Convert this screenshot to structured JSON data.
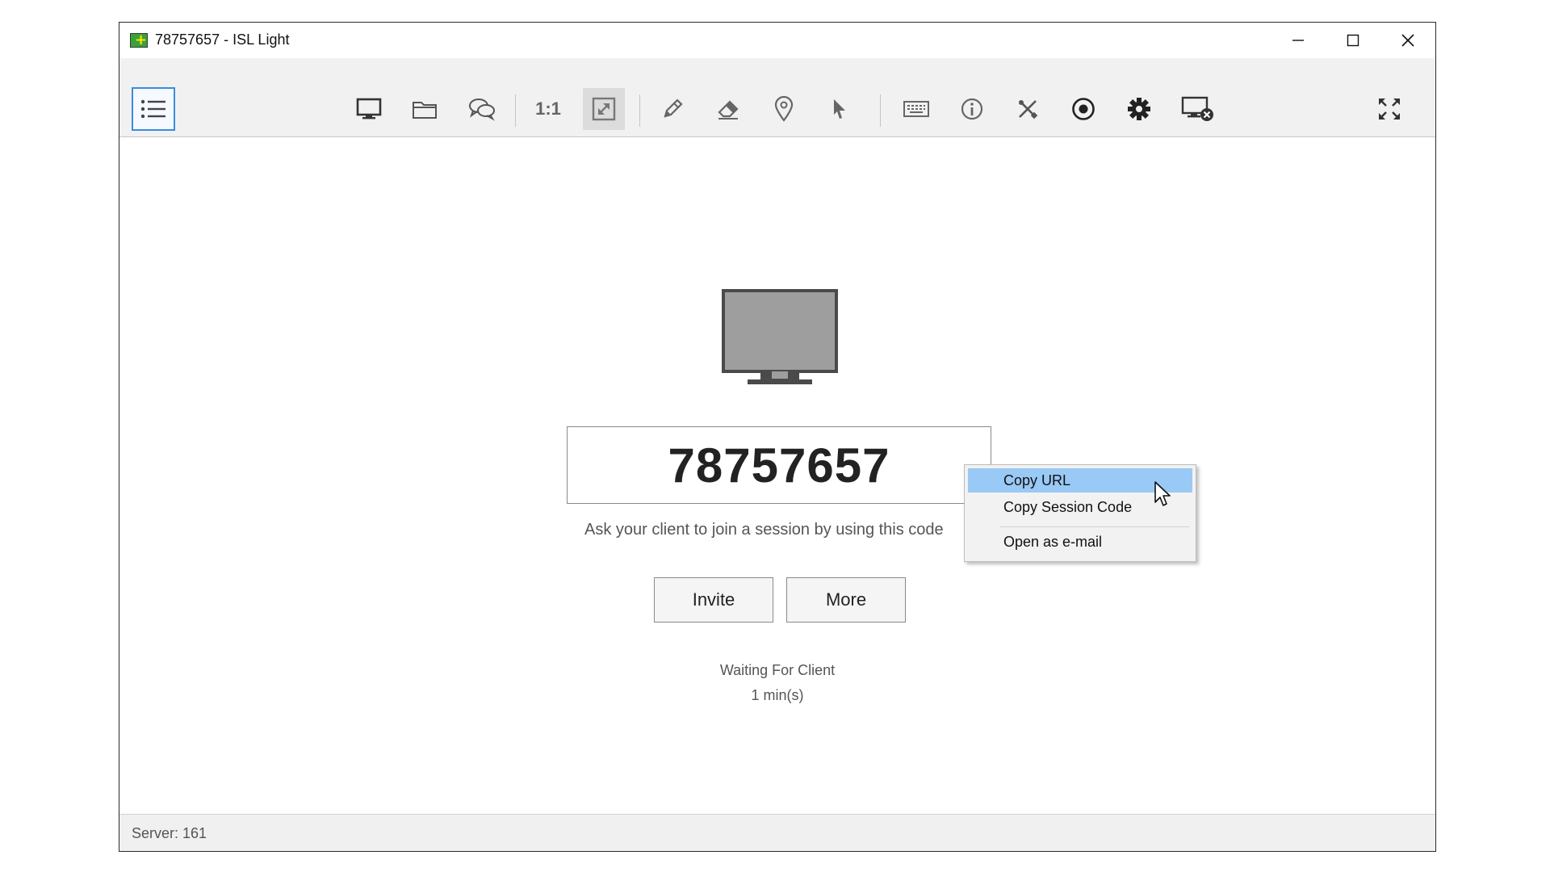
{
  "window": {
    "title": "78757657 - ISL Light",
    "controls": {
      "minimize_glyph": "—",
      "maximize_glyph": "☐",
      "close_glyph": "✕"
    }
  },
  "toolbar": {
    "menu_icon": "list-icon",
    "items": [
      {
        "name": "screen-share",
        "icon": "monitor-icon"
      },
      {
        "name": "file-transfer",
        "icon": "folder-icon"
      },
      {
        "name": "chat",
        "icon": "chat-icon"
      },
      {
        "name": "actual-size",
        "icon": "one-to-one-icon",
        "label": "1:1"
      },
      {
        "name": "scale-to-fit",
        "icon": "scale-icon",
        "active": true
      },
      {
        "name": "pen",
        "icon": "pencil-icon"
      },
      {
        "name": "eraser",
        "icon": "eraser-icon"
      },
      {
        "name": "pointer-marker",
        "icon": "map-pin-icon"
      },
      {
        "name": "pointer",
        "icon": "cursor-arrow-icon"
      },
      {
        "name": "keyboard",
        "icon": "keyboard-icon"
      },
      {
        "name": "info",
        "icon": "info-icon"
      },
      {
        "name": "tools",
        "icon": "tools-icon"
      },
      {
        "name": "record",
        "icon": "record-icon"
      },
      {
        "name": "settings",
        "icon": "gear-icon"
      },
      {
        "name": "disconnect",
        "icon": "monitor-close-icon"
      }
    ],
    "fullscreen_icon": "fullscreen-icon"
  },
  "session": {
    "code": "78757657",
    "hint": "Ask your client to join a session by using this code",
    "invite_label": "Invite",
    "more_label": "More",
    "status": "Waiting For Client",
    "elapsed": "1 min(s)"
  },
  "context_menu": {
    "items": [
      {
        "label": "Copy URL",
        "highlighted": true
      },
      {
        "label": "Copy Session Code",
        "highlighted": false
      },
      {
        "label": "Open as e-mail",
        "highlighted": false
      }
    ]
  },
  "statusbar": {
    "server": "Server: 161"
  },
  "colors": {
    "highlight": "#99c9f5",
    "menu_button_border": "#3a8be0",
    "icon_gray": "#555555"
  }
}
